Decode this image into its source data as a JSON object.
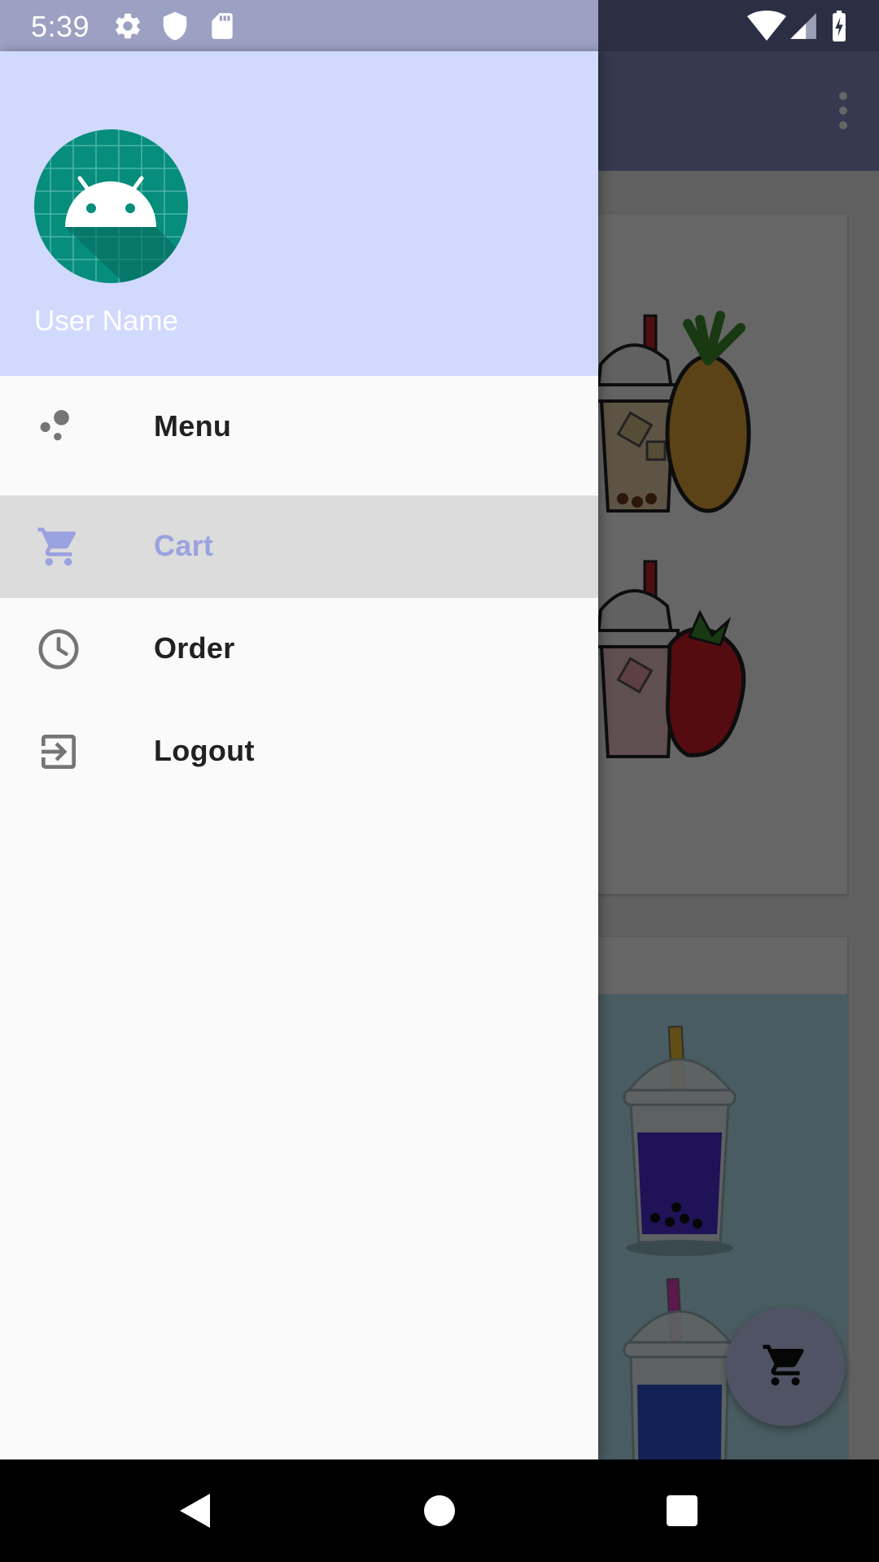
{
  "status_bar": {
    "time": "5:39",
    "icons": [
      "settings-icon",
      "shield-icon",
      "sd-card-icon",
      "wifi-icon",
      "signal-icon",
      "battery-charging-icon"
    ]
  },
  "drawer": {
    "header": {
      "user_name": "User Name",
      "avatar": "android-avatar-icon",
      "background_color": "#d1d9fd"
    },
    "items": [
      {
        "label": "Menu",
        "icon": "bubbles-icon",
        "selected": false
      },
      {
        "label": "Cart",
        "icon": "cart-icon",
        "selected": true
      },
      {
        "label": "Order",
        "icon": "clock-icon",
        "selected": false
      },
      {
        "label": "Logout",
        "icon": "exit-icon",
        "selected": false
      }
    ],
    "selected_color": "#9aa2e0"
  },
  "app": {
    "toolbar_color": "#8890c8",
    "overflow_icon": "more-vert-icon",
    "fab_icon": "cart-icon",
    "cards": [
      {
        "image": "pineapple-and-strawberry-iced-tea-illustration"
      },
      {
        "image": "bubble-tea-cups-illustration"
      }
    ]
  },
  "nav_bar": {
    "buttons": [
      "back-icon",
      "home-icon",
      "recents-icon"
    ]
  }
}
